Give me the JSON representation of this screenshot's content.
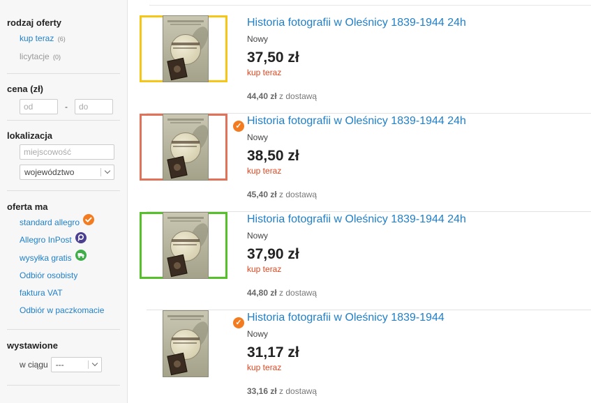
{
  "sidebar": {
    "offer_type": {
      "title": "rodzaj oferty",
      "items": [
        {
          "label": "kup teraz",
          "count": "(6)"
        },
        {
          "label": "licytacje",
          "count": "(0)"
        }
      ]
    },
    "price": {
      "title": "cena (zł)",
      "from_placeholder": "od",
      "separator": "-",
      "to_placeholder": "do"
    },
    "location": {
      "title": "lokalizacja",
      "city_placeholder": "miejscowość",
      "region_value": "województwo"
    },
    "offer_has": {
      "title": "oferta ma",
      "items": [
        {
          "label": "standard allegro",
          "icon": "check-badge-icon"
        },
        {
          "label": "Allegro InPost",
          "icon": "inpost-icon"
        },
        {
          "label": "wysyłka gratis",
          "icon": "free-shipping-icon"
        },
        {
          "label": "Odbiór osobisty"
        },
        {
          "label": "faktura VAT"
        },
        {
          "label": "Odbiór w paczkomacie"
        }
      ]
    },
    "listed": {
      "title": "wystawione",
      "within_label": "w ciągu",
      "within_value": "---"
    }
  },
  "offers": [
    {
      "title": "Historia fotografii w Oleśnicy 1839-1944 24h",
      "condition": "Nowy",
      "price": "37,50 zł",
      "buy_label": "kup teraz",
      "shipping_price": "44,40 zł",
      "shipping_label": "z dostawą",
      "standard_badge": false,
      "frame_color": "#f5c518"
    },
    {
      "title": "Historia fotografii w Oleśnicy 1839-1944 24h",
      "condition": "Nowy",
      "price": "38,50 zł",
      "buy_label": "kup teraz",
      "shipping_price": "45,40 zł",
      "shipping_label": "z dostawą",
      "standard_badge": true,
      "frame_color": "#e0725a"
    },
    {
      "title": "Historia fotografii w Oleśnicy 1839-1944 24h",
      "condition": "Nowy",
      "price": "37,90 zł",
      "buy_label": "kup teraz",
      "shipping_price": "44,80 zł",
      "shipping_label": "z dostawą",
      "standard_badge": false,
      "frame_color": "#56c02b"
    },
    {
      "title": "Historia fotografii w Oleśnicy 1839-1944",
      "condition": "Nowy",
      "price": "31,17 zł",
      "buy_label": "kup teraz",
      "shipping_price": "33,16 zł",
      "shipping_label": "z dostawą",
      "standard_badge": true,
      "frame_color": ""
    }
  ],
  "colors": {
    "link": "#1f7fc9",
    "buy_now": "#e2461f",
    "badge_orange": "#f47c20",
    "inpost_purple": "#4b3f8f",
    "free_shipping_green": "#3fae49"
  }
}
